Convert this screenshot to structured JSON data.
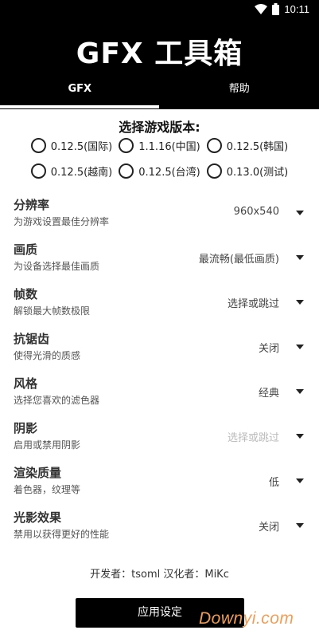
{
  "status_bar": {
    "time": "10:11"
  },
  "app": {
    "title": "GFX 工具箱"
  },
  "tabs": [
    {
      "label": "GFX",
      "active": true
    },
    {
      "label": "帮助",
      "active": false
    }
  ],
  "version_section": {
    "title": "选择游戏版本:",
    "options": [
      {
        "label": "0.12.5(国际)",
        "selected": false
      },
      {
        "label": "1.1.16(中国)",
        "selected": false
      },
      {
        "label": "0.12.5(韩国)",
        "selected": false
      },
      {
        "label": "0.12.5(越南)",
        "selected": false
      },
      {
        "label": "0.12.5(台湾)",
        "selected": false
      },
      {
        "label": "0.13.0(测试)",
        "selected": false
      }
    ]
  },
  "settings": [
    {
      "title": "分辨率",
      "desc": "为游戏设置最佳分辨率",
      "value": "960x540",
      "enabled": true
    },
    {
      "title": "画质",
      "desc": "为设备选择最佳画质",
      "value": "最流畅(最低画质)",
      "enabled": true
    },
    {
      "title": "帧数",
      "desc": "解锁最大帧数极限",
      "value": "选择或跳过",
      "enabled": true
    },
    {
      "title": "抗锯齿",
      "desc": "使得光滑的质感",
      "value": "关闭",
      "enabled": true
    },
    {
      "title": "风格",
      "desc": "选择您喜欢的滤色器",
      "value": "经典",
      "enabled": true
    },
    {
      "title": "阴影",
      "desc": "启用或禁用阴影",
      "value": "选择或跳过",
      "enabled": false
    },
    {
      "title": "渲染质量",
      "desc": "着色器，纹理等",
      "value": "低",
      "enabled": true
    },
    {
      "title": "光影效果",
      "desc": "禁用以获得更好的性能",
      "value": "关闭",
      "enabled": true
    }
  ],
  "footer": {
    "credits": "开发者：tsoml 汉化者：MiKc",
    "apply_label": "应用设定"
  },
  "watermark": "Downyi.com"
}
